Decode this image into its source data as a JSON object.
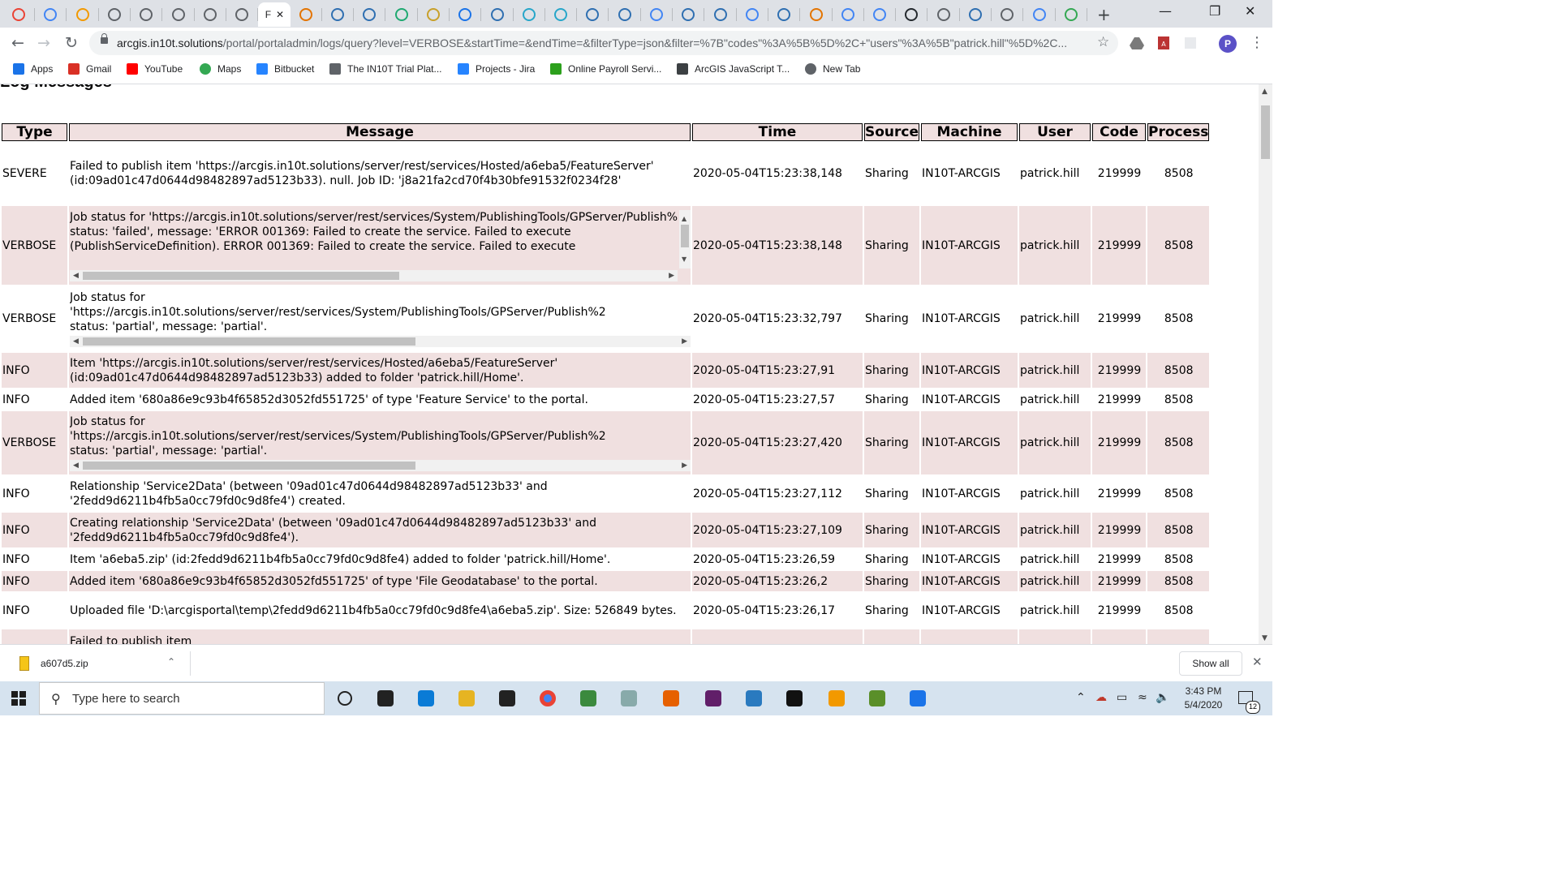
{
  "browser": {
    "tab_count": 34,
    "active_tab_label": "F",
    "new_tab_symbol": "+",
    "address": {
      "host": "arcgis.in10t.solutions",
      "path": "/portal/portaladmin/logs/query?level=VERBOSE&startTime=&endTime=&filterType=json&filter=%7B\"codes\"%3A%5B%5D%2C+\"users\"%3A%5B\"patrick.hill\"%5D%2C..."
    },
    "profile_initial": "P"
  },
  "bookmarks": [
    {
      "label": "Apps",
      "icon": "apps-grid-icon",
      "color": "#1a73e8"
    },
    {
      "label": "Gmail",
      "icon": "gmail-icon",
      "color": "#d93025"
    },
    {
      "label": "YouTube",
      "icon": "youtube-icon",
      "color": "#ff0000"
    },
    {
      "label": "Maps",
      "icon": "maps-pin-icon",
      "color": "#34a853"
    },
    {
      "label": "Bitbucket",
      "icon": "bitbucket-icon",
      "color": "#2684ff"
    },
    {
      "label": "The IN10T Trial Plat...",
      "icon": "in10t-icon",
      "color": "#5f6368"
    },
    {
      "label": "Projects - Jira",
      "icon": "jira-icon",
      "color": "#2684ff"
    },
    {
      "label": "Online Payroll Servi...",
      "icon": "payroll-icon",
      "color": "#2ca01c"
    },
    {
      "label": "ArcGIS JavaScript T...",
      "icon": "arcgis-icon",
      "color": "#3c4043"
    },
    {
      "label": "New Tab",
      "icon": "globe-icon",
      "color": "#5f6368"
    }
  ],
  "page": {
    "heading": "Log Messages"
  },
  "table": {
    "headers": [
      "Type",
      "Message",
      "Time",
      "Source",
      "Machine",
      "User",
      "Code",
      "Process"
    ],
    "rows": [
      {
        "type": "SEVERE",
        "message": "Failed to publish item 'https://arcgis.in10t.solutions/server/rest/services/Hosted/a6eba5/FeatureServer' (id:09ad01c47d0644d98482897ad5123b33). null. Job ID: 'j8a21fa2cd70f4b30bfe91532f0234f28'",
        "time": "2020-05-04T15:23:38,148",
        "source": "Sharing",
        "machine": "IN10T-ARCGIS",
        "user": "patrick.hill",
        "code": "219999",
        "process": "8508"
      },
      {
        "type": "VERBOSE",
        "message": "Job status for 'https://arcgis.in10t.solutions/server/rest/services/System/PublishingTools/GPServer/Publish%\nstatus: 'failed', message: 'ERROR 001369: Failed to create the service. Failed to execute\n(PublishServiceDefinition). ERROR 001369: Failed to create the service. Failed to execute",
        "time": "2020-05-04T15:23:38,148",
        "source": "Sharing",
        "machine": "IN10T-ARCGIS",
        "user": "patrick.hill",
        "code": "219999",
        "process": "8508"
      },
      {
        "type": "VERBOSE",
        "message": "Job status for\n'https://arcgis.in10t.solutions/server/rest/services/System/PublishingTools/GPServer/Publish%2\nstatus: 'partial', message: 'partial'.",
        "time": "2020-05-04T15:23:32,797",
        "source": "Sharing",
        "machine": "IN10T-ARCGIS",
        "user": "patrick.hill",
        "code": "219999",
        "process": "8508"
      },
      {
        "type": "INFO",
        "message": "Item 'https://arcgis.in10t.solutions/server/rest/services/Hosted/a6eba5/FeatureServer' (id:09ad01c47d0644d98482897ad5123b33) added to folder 'patrick.hill/Home'.",
        "time": "2020-05-04T15:23:27,91",
        "source": "Sharing",
        "machine": "IN10T-ARCGIS",
        "user": "patrick.hill",
        "code": "219999",
        "process": "8508"
      },
      {
        "type": "INFO",
        "message": "Added item '680a86e9c93b4f65852d3052fd551725' of type 'Feature Service' to the portal.",
        "time": "2020-05-04T15:23:27,57",
        "source": "Sharing",
        "machine": "IN10T-ARCGIS",
        "user": "patrick.hill",
        "code": "219999",
        "process": "8508"
      },
      {
        "type": "VERBOSE",
        "message": "Job status for\n'https://arcgis.in10t.solutions/server/rest/services/System/PublishingTools/GPServer/Publish%2\nstatus: 'partial', message: 'partial'.",
        "time": "2020-05-04T15:23:27,420",
        "source": "Sharing",
        "machine": "IN10T-ARCGIS",
        "user": "patrick.hill",
        "code": "219999",
        "process": "8508"
      },
      {
        "type": "INFO",
        "message": "Relationship 'Service2Data' (between '09ad01c47d0644d98482897ad5123b33' and '2fedd9d6211b4fb5a0cc79fd0c9d8fe4') created.",
        "time": "2020-05-04T15:23:27,112",
        "source": "Sharing",
        "machine": "IN10T-ARCGIS",
        "user": "patrick.hill",
        "code": "219999",
        "process": "8508"
      },
      {
        "type": "INFO",
        "message": "Creating relationship 'Service2Data' (between '09ad01c47d0644d98482897ad5123b33' and '2fedd9d6211b4fb5a0cc79fd0c9d8fe4').",
        "time": "2020-05-04T15:23:27,109",
        "source": "Sharing",
        "machine": "IN10T-ARCGIS",
        "user": "patrick.hill",
        "code": "219999",
        "process": "8508"
      },
      {
        "type": "INFO",
        "message": "Item 'a6eba5.zip' (id:2fedd9d6211b4fb5a0cc79fd0c9d8fe4) added to folder 'patrick.hill/Home'.",
        "time": "2020-05-04T15:23:26,59",
        "source": "Sharing",
        "machine": "IN10T-ARCGIS",
        "user": "patrick.hill",
        "code": "219999",
        "process": "8508"
      },
      {
        "type": "INFO",
        "message": "Added item '680a86e9c93b4f65852d3052fd551725' of type 'File Geodatabase' to the portal.",
        "time": "2020-05-04T15:23:26,2",
        "source": "Sharing",
        "machine": "IN10T-ARCGIS",
        "user": "patrick.hill",
        "code": "219999",
        "process": "8508"
      },
      {
        "type": "INFO",
        "message": "Uploaded file 'D:\\arcgisportal\\temp\\2fedd9d6211b4fb5a0cc79fd0c9d8fe4\\a6eba5.zip'. Size: 526849 bytes.",
        "time": "2020-05-04T15:23:26,17",
        "source": "Sharing",
        "machine": "IN10T-ARCGIS",
        "user": "patrick.hill",
        "code": "219999",
        "process": "8508"
      },
      {
        "type": "",
        "message": "Failed to publish item",
        "time": "",
        "source": "",
        "machine": "",
        "user": "",
        "code": "",
        "process": ""
      }
    ]
  },
  "downloads": {
    "file_name": "a607d5.zip",
    "show_all_label": "Show all"
  },
  "taskbar": {
    "search_placeholder": "Type here to search",
    "time": "3:43 PM",
    "date": "5/4/2020",
    "notification_count": "12"
  }
}
